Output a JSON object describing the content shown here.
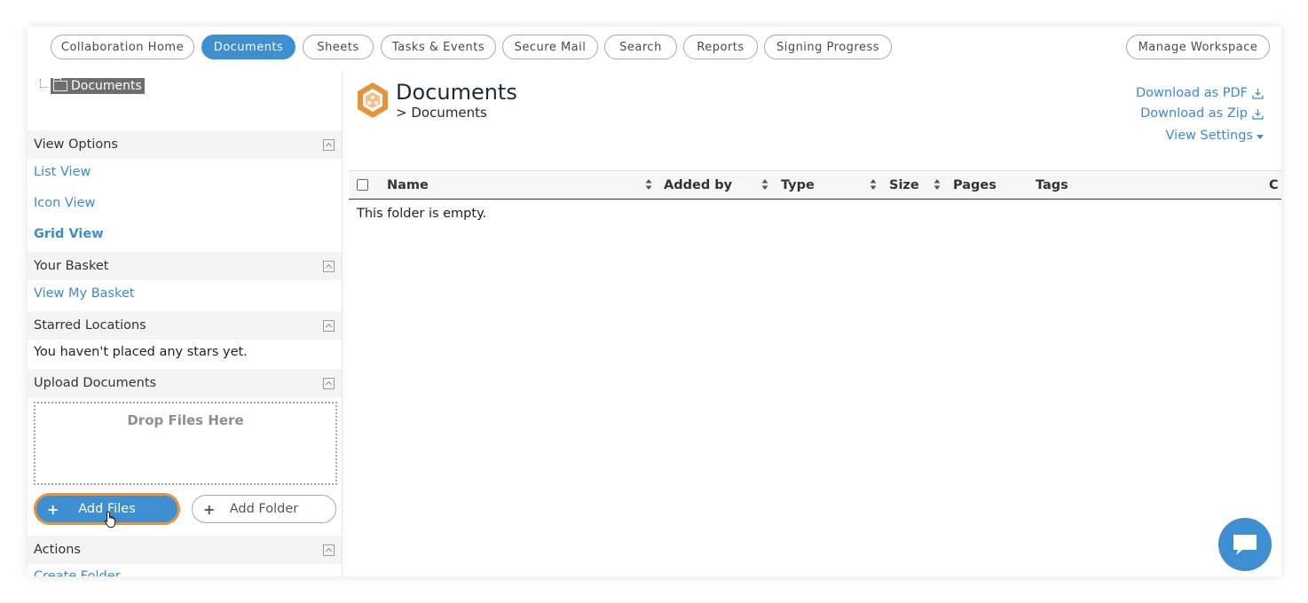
{
  "nav": {
    "tabs": [
      {
        "label": "Collaboration Home"
      },
      {
        "label": "Documents"
      },
      {
        "label": "Sheets"
      },
      {
        "label": "Tasks & Events"
      },
      {
        "label": "Secure Mail"
      },
      {
        "label": "Search"
      },
      {
        "label": "Reports"
      },
      {
        "label": "Signing Progress"
      }
    ],
    "active_tab": "Documents",
    "manage_label": "Manage Workspace"
  },
  "sidebar": {
    "tree": {
      "root_label": "Documents",
      "icon": "folder-icon"
    },
    "view_options": {
      "header": "View Options",
      "items": [
        {
          "label": "List View"
        },
        {
          "label": "Icon View"
        },
        {
          "label": "Grid View"
        }
      ],
      "selected": "Grid View"
    },
    "basket": {
      "header": "Your Basket",
      "link": "View My Basket"
    },
    "starred": {
      "header": "Starred Locations",
      "message": "You haven't placed any stars yet."
    },
    "upload": {
      "header": "Upload Documents",
      "drop_label": "Drop Files Here",
      "add_files_label": "Add Files",
      "add_folder_label": "Add Folder"
    },
    "actions": {
      "header": "Actions",
      "first_item": "Create Folder"
    }
  },
  "main": {
    "title": "Documents",
    "breadcrumb": "> Documents",
    "links": {
      "download_pdf": "Download as PDF",
      "download_zip": "Download as Zip",
      "view_settings": "View Settings"
    },
    "table": {
      "columns": [
        "Name",
        "Added by",
        "Type",
        "Size",
        "Pages",
        "Tags",
        "C"
      ],
      "empty_message": "This folder is empty."
    }
  },
  "colors": {
    "accent": "#3d8fd1",
    "link": "#3a8ccb",
    "focus_ring": "#e8923a",
    "logo": "#e8923a"
  }
}
